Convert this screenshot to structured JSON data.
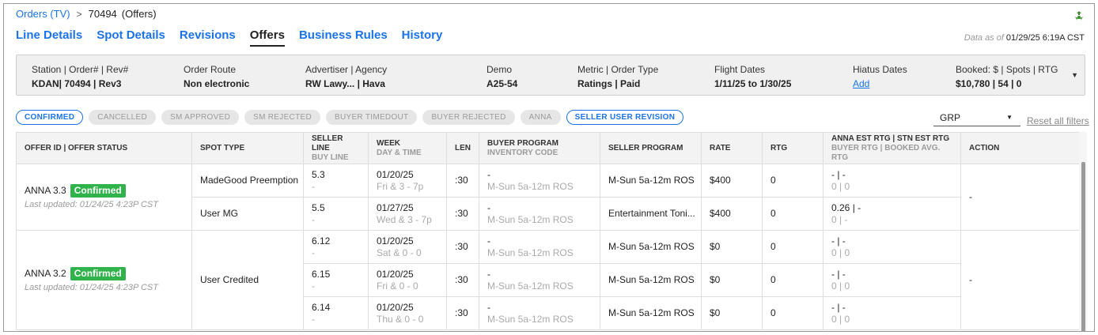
{
  "breadcrumb": {
    "orders_link": "Orders (TV)",
    "separator": ">",
    "order_number": "70494",
    "section": "(Offers)"
  },
  "tabs": [
    {
      "label": "Line Details",
      "active": false
    },
    {
      "label": "Spot Details",
      "active": false
    },
    {
      "label": "Revisions",
      "active": false
    },
    {
      "label": "Offers",
      "active": true
    },
    {
      "label": "Business Rules",
      "active": false
    },
    {
      "label": "History",
      "active": false
    }
  ],
  "data_as_of": {
    "label": "Data as of",
    "timestamp": "01/29/25 6:19A CST"
  },
  "summary": {
    "station": {
      "label": "Station | Order# | Rev#",
      "value": "KDAN| 70494   | Rev3"
    },
    "order_route": {
      "label": "Order Route",
      "value": "Non electronic"
    },
    "advertiser": {
      "label": "Advertiser | Agency",
      "value": "RW Lawy...  | Hava"
    },
    "demo": {
      "label": "Demo",
      "value": "A25-54"
    },
    "metric": {
      "label": "Metric | Order Type",
      "value": "Ratings | Paid"
    },
    "flight": {
      "label": "Flight Dates",
      "value": "1/11/25 to 1/30/25"
    },
    "hiatus": {
      "label": "Hiatus Dates",
      "value": "Add"
    },
    "booked": {
      "label": "Booked: $ | Spots | RTG",
      "value": "$10,780 | 54 | 0"
    }
  },
  "filters": [
    {
      "label": "CONFIRMED",
      "selected": true
    },
    {
      "label": "CANCELLED",
      "selected": false
    },
    {
      "label": "SM APPROVED",
      "selected": false
    },
    {
      "label": "SM REJECTED",
      "selected": false
    },
    {
      "label": "BUYER TIMEDOUT",
      "selected": false
    },
    {
      "label": "BUYER REJECTED",
      "selected": false
    },
    {
      "label": "ANNA",
      "selected": false
    },
    {
      "label": "SELLER USER REVISION",
      "selected": true
    }
  ],
  "metric_select": {
    "value": "GRP"
  },
  "reset_filters": "Reset all filters",
  "table": {
    "headers": {
      "offer": "OFFER ID | OFFER STATUS",
      "spot_type": "SPOT TYPE",
      "seller_line": "SELLER LINE",
      "buy_line": "BUY LINE",
      "week": "WEEK",
      "day_time": "DAY & TIME",
      "len": "LEN",
      "buyer_program": "BUYER PROGRAM",
      "inventory_code": "INVENTORY CODE",
      "seller_program": "SELLER PROGRAM",
      "rate": "RATE",
      "rtg": "RTG",
      "est_rtg": "ANNA EST RTG | STN EST RTG",
      "buyer_rtg": "BUYER RTG | BOOKED AVG. RTG",
      "action": "ACTION"
    },
    "groups": [
      {
        "offer_id": "ANNA 3.3",
        "status": "Confirmed",
        "updated": "Last updated: 01/24/25 4:23P CST",
        "action": "-",
        "rows": [
          {
            "spot_type": "MadeGood Preemption",
            "seller_line": "5.3",
            "buy_line": "-",
            "week": "01/20/25",
            "day_time": "Fri & 3 - 7p",
            "len": ":30",
            "buyer_program": "-",
            "inventory_code": "M-Sun 5a-12m ROS",
            "seller_program": "M-Sun 5a-12m ROS",
            "rate": "$400",
            "rtg": "0",
            "est_rtg": "- | -",
            "buyer_rtg": "0 | 0"
          },
          {
            "spot_type": "User MG",
            "seller_line": "5.5",
            "buy_line": "-",
            "week": "01/27/25",
            "day_time": "Wed & 3 - 7p",
            "len": ":30",
            "buyer_program": "-",
            "inventory_code": "M-Sun 5a-12m ROS",
            "seller_program": "Entertainment Toni...",
            "rate": "$400",
            "rtg": "0",
            "est_rtg": "0.26 | -",
            "buyer_rtg": "0 | -"
          }
        ]
      },
      {
        "offer_id": "ANNA 3.2",
        "status": "Confirmed",
        "updated": "Last updated: 01/24/25 4:23P CST",
        "action": "-",
        "spot_type": "User Credited",
        "rows": [
          {
            "seller_line": "6.12",
            "buy_line": "-",
            "week": "01/20/25",
            "day_time": "Sat & 0 - 0",
            "len": ":30",
            "buyer_program": "-",
            "inventory_code": "M-Sun 5a-12m ROS",
            "seller_program": "M-Sun 5a-12m ROS",
            "rate": "$0",
            "rtg": "0",
            "est_rtg": "- | -",
            "buyer_rtg": "0 | 0"
          },
          {
            "seller_line": "6.15",
            "buy_line": "-",
            "week": "01/20/25",
            "day_time": "Fri & 0 - 0",
            "len": ":30",
            "buyer_program": "-",
            "inventory_code": "M-Sun 5a-12m ROS",
            "seller_program": "M-Sun 5a-12m ROS",
            "rate": "$0",
            "rtg": "0",
            "est_rtg": "- | -",
            "buyer_rtg": "0 | 0"
          },
          {
            "seller_line": "6.14",
            "buy_line": "-",
            "week": "01/20/25",
            "day_time": "Thu & 0 - 0",
            "len": ":30",
            "buyer_program": "-",
            "inventory_code": "M-Sun 5a-12m ROS",
            "seller_program": "M-Sun 5a-12m ROS",
            "rate": "$0",
            "rtg": "0",
            "est_rtg": "- | -",
            "buyer_rtg": "0 | 0"
          }
        ]
      }
    ]
  },
  "colors": {
    "link": "#1a73e8",
    "confirmed_badge": "#2fb34a",
    "summary_bg": "#f0f0f0"
  }
}
